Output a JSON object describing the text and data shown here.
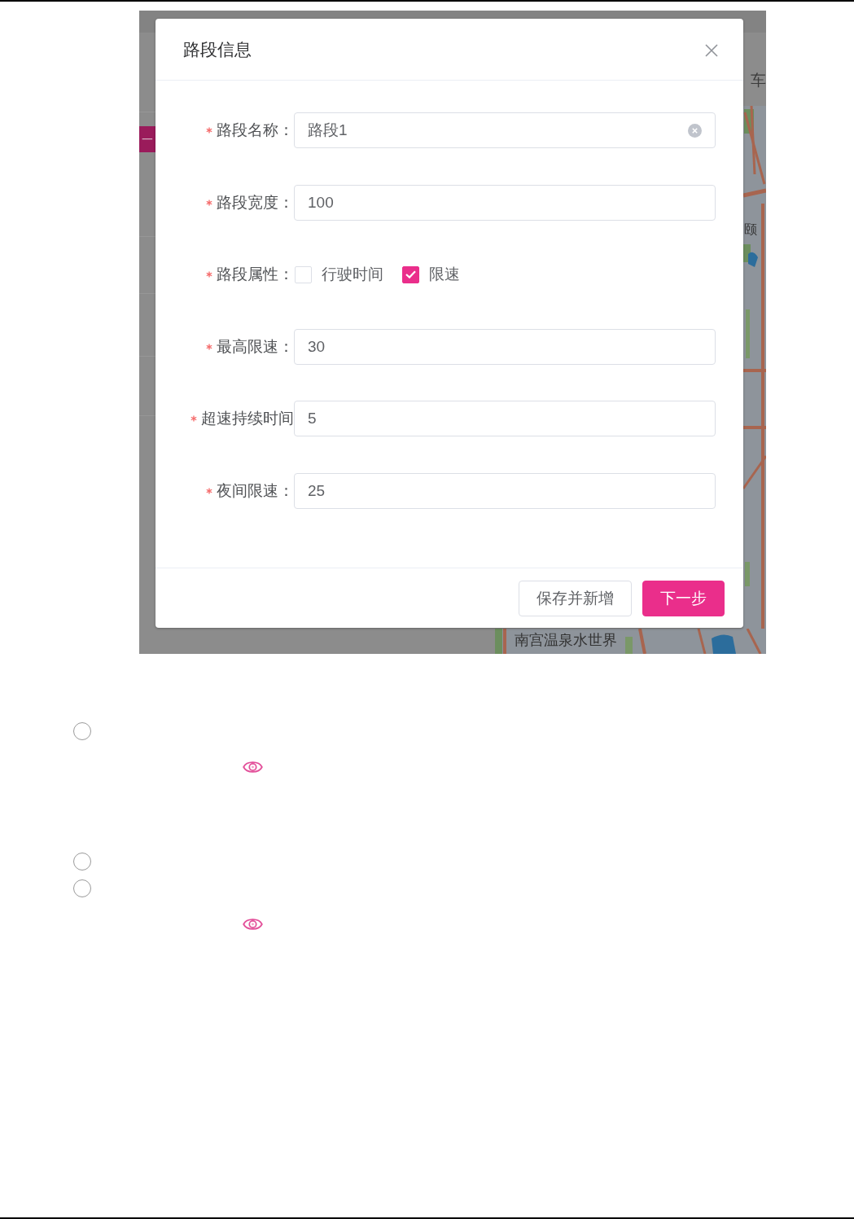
{
  "background": {
    "side_button": {
      "label": "一"
    },
    "map": {
      "title": "车",
      "labels": [
        "颐",
        "南宫温泉水世界"
      ]
    }
  },
  "dialog": {
    "title": "路段信息",
    "fields": [
      {
        "kind": "input",
        "label": "路段名称：",
        "required": true,
        "value": "路段1",
        "clearable": true
      },
      {
        "kind": "input",
        "label": "路段宽度：",
        "required": true,
        "value": "100",
        "clearable": false
      },
      {
        "kind": "checkbox_group",
        "label": "路段属性：",
        "required": true,
        "options": [
          {
            "label": "行驶时间",
            "checked": false
          },
          {
            "label": "限速",
            "checked": true
          }
        ]
      },
      {
        "kind": "input",
        "label": "最高限速：",
        "required": true,
        "value": "30",
        "clearable": false
      },
      {
        "kind": "input",
        "label": "超速持续时间",
        "required": true,
        "value": "5",
        "clearable": false
      },
      {
        "kind": "input",
        "label": "夜间限速：",
        "required": true,
        "value": "25",
        "clearable": false
      }
    ],
    "buttons": [
      {
        "label": "保存并新增",
        "kind": "default"
      },
      {
        "label": "下一步",
        "kind": "primary"
      }
    ]
  },
  "options": [
    {
      "selected": false,
      "preview": true
    },
    {
      "selected": false,
      "preview": false
    },
    {
      "selected": false,
      "preview": true
    }
  ]
}
